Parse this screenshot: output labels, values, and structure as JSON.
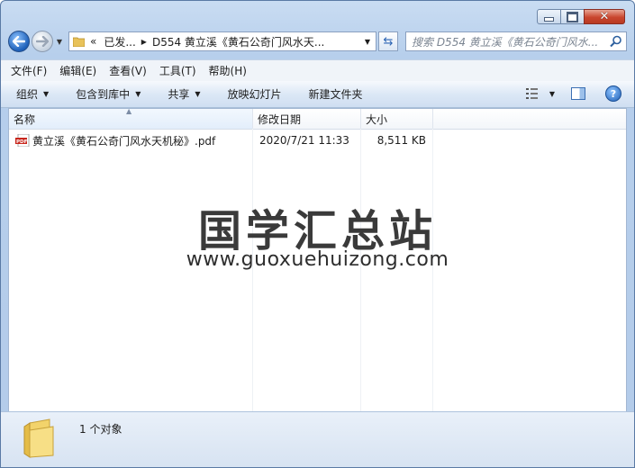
{
  "breadcrumb": {
    "overflow": "«",
    "segment_1": "已发...",
    "segment_2": "D554 黄立溪《黄石公奇门风水天..."
  },
  "search": {
    "placeholder": "搜索 D554 黄立溪《黄石公奇门风水..."
  },
  "menu": {
    "items": [
      "文件(F)",
      "编辑(E)",
      "查看(V)",
      "工具(T)",
      "帮助(H)"
    ]
  },
  "toolbar": {
    "organize": "组织",
    "include_in_library": "包含到库中",
    "share": "共享",
    "slideshow": "放映幻灯片",
    "new_folder": "新建文件夹"
  },
  "columns": {
    "name": "名称",
    "date": "修改日期",
    "size": "大小"
  },
  "files": [
    {
      "name": "黄立溪《黄石公奇门风水天机秘》.pdf",
      "date": "2020/7/21 11:33",
      "size": "8,511 KB"
    }
  ],
  "watermark": {
    "title": "国学汇总站",
    "url": "www.guoxuehuizong.com"
  },
  "status": {
    "count": "1 个对象"
  }
}
